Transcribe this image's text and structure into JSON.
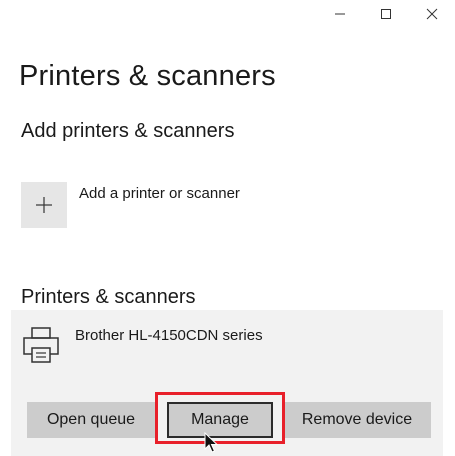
{
  "window": {
    "controls": [
      "minimize",
      "maximize",
      "close"
    ]
  },
  "page": {
    "title": "Printers & scanners"
  },
  "add_section": {
    "heading": "Add printers & scanners",
    "add_label": "Add a printer or scanner",
    "add_icon": "plus-icon"
  },
  "list_section": {
    "heading": "Printers & scanners",
    "printers": [
      {
        "name": "Brother HL-4150CDN series",
        "icon": "printer-icon",
        "actions": {
          "open_queue": "Open queue",
          "manage": "Manage",
          "remove": "Remove device"
        }
      }
    ]
  },
  "colors": {
    "highlight": "#e8202a",
    "tile_background": "#e6e6e6",
    "selected_item": "#f2f2f2",
    "button": "#cccccc"
  }
}
